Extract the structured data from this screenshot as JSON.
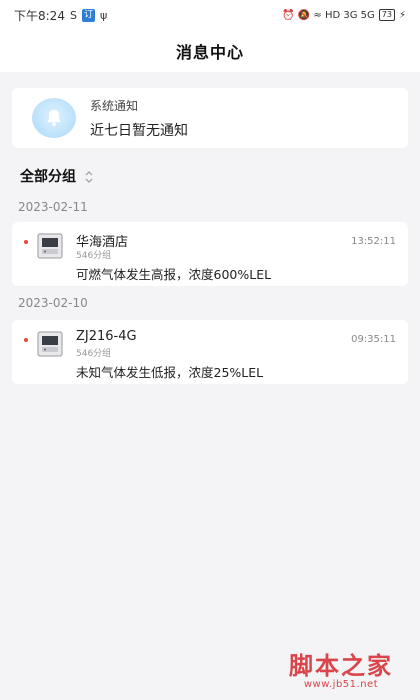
{
  "status_bar": {
    "time": "下午8:24",
    "left_extra": "S",
    "app_box": "订",
    "usb": "ψ",
    "right_text": "⏰ 🔕 ≈ HD 3G 5G",
    "battery": "73",
    "charge": "⚡"
  },
  "header": {
    "title": "消息中心"
  },
  "system_notice": {
    "icon": "bell-icon",
    "title": "系统通知",
    "subtitle": "近七日暂无通知"
  },
  "group_filter": {
    "label": "全部分组",
    "icon": "sort-icon"
  },
  "message_groups": [
    {
      "date": "2023-02-11",
      "messages": [
        {
          "name": "华海酒店",
          "group": "546分组",
          "time": "13:52:11",
          "body": "可燃气体发生高报，浓度600%LEL",
          "unread": true,
          "icon": "gas-detector-icon"
        }
      ]
    },
    {
      "date": "2023-02-10",
      "messages": [
        {
          "name": "ZJ216-4G",
          "group": "546分组",
          "time": "09:35:11",
          "body": "未知气体发生低报，浓度25%LEL",
          "unread": true,
          "icon": "gas-detector-icon"
        }
      ]
    }
  ],
  "watermark": {
    "main": "脚本之家",
    "url": "www.jb51.net"
  },
  "colors": {
    "background": "#f4f4f6",
    "card": "#ffffff",
    "unread_dot": "#e04a3b",
    "watermark": "#d9454a"
  }
}
